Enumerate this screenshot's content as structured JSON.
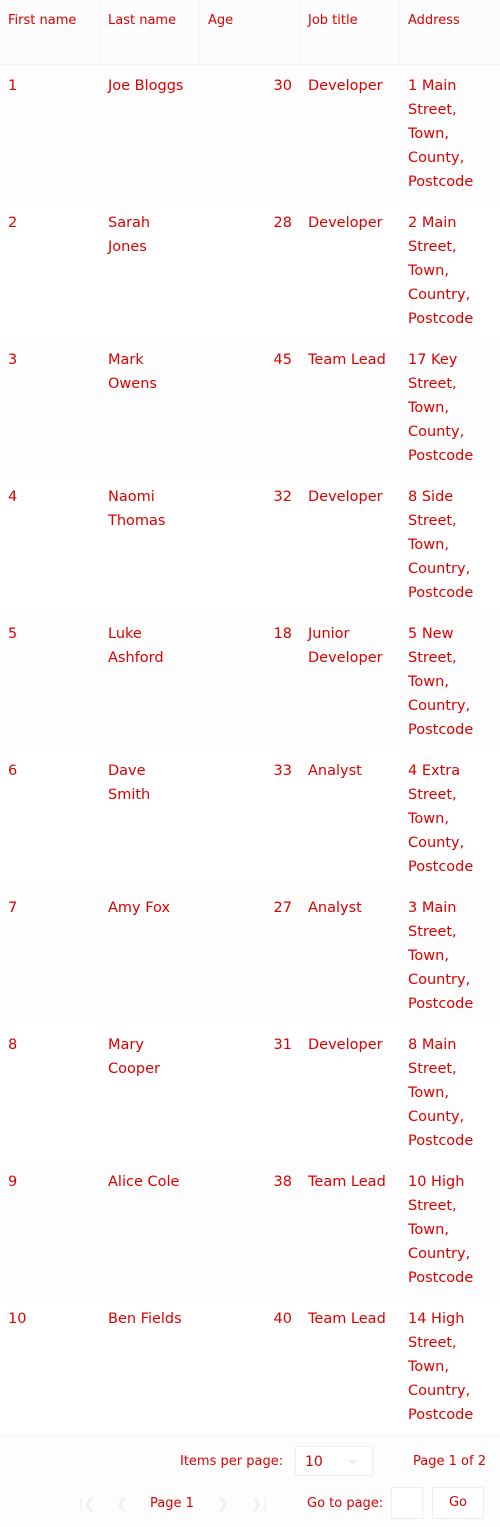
{
  "table": {
    "headers": {
      "first_name": "First name",
      "last_name": "Last name",
      "age": "Age",
      "job_title": "Job title",
      "address": "Address"
    },
    "rows": [
      {
        "first": "1",
        "last": "Joe Bloggs",
        "age": "30",
        "job": "Developer",
        "address": "1 Main Street, Town, County, Postcode"
      },
      {
        "first": "2",
        "last": "Sarah Jones",
        "age": "28",
        "job": "Developer",
        "address": "2 Main Street, Town, Country, Postcode"
      },
      {
        "first": "3",
        "last": "Mark Owens",
        "age": "45",
        "job": "Team Lead",
        "address": "17 Key Street, Town, County, Postcode"
      },
      {
        "first": "4",
        "last": "Naomi Thomas",
        "age": "32",
        "job": "Developer",
        "address": "8 Side Street, Town, Country, Postcode"
      },
      {
        "first": "5",
        "last": "Luke Ashford",
        "age": "18",
        "job": "Junior Developer",
        "address": "5 New Street, Town, Country, Postcode"
      },
      {
        "first": "6",
        "last": "Dave Smith",
        "age": "33",
        "job": "Analyst",
        "address": "4 Extra Street, Town, County, Postcode"
      },
      {
        "first": "7",
        "last": "Amy Fox",
        "age": "27",
        "job": "Analyst",
        "address": "3 Main Street, Town, Country, Postcode"
      },
      {
        "first": "8",
        "last": "Mary Cooper",
        "age": "31",
        "job": "Developer",
        "address": "8 Main Street, Town, County, Postcode"
      },
      {
        "first": "9",
        "last": "Alice Cole",
        "age": "38",
        "job": "Team Lead",
        "address": "10 High Street, Town, Country, Postcode"
      },
      {
        "first": "10",
        "last": "Ben Fields",
        "age": "40",
        "job": "Team Lead",
        "address": "14 High Street, Town, Country, Postcode"
      }
    ]
  },
  "pagination": {
    "items_per_page_label": "Items per page:",
    "items_per_page_value": "10",
    "page_of": "Page 1 of 2",
    "page_label": "Page 1",
    "goto_label": "Go to page:",
    "goto_value": "",
    "go_button": "Go",
    "icons": {
      "first": "first-page-icon",
      "prev": "previous-page-icon",
      "next": "next-page-icon",
      "last": "last-page-icon",
      "dropdown": "chevron-down-icon"
    }
  },
  "colors": {
    "text": "#dd0000",
    "disabled": "#f0f0f0",
    "border": "#eeeeee"
  }
}
